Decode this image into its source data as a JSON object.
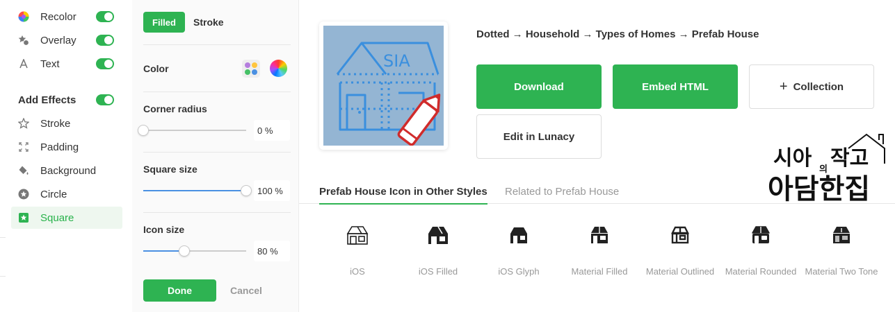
{
  "sidebar": {
    "items": [
      {
        "label": "Recolor",
        "icon": "palette-icon",
        "toggle": true
      },
      {
        "label": "Overlay",
        "icon": "overlay-shapes-icon",
        "toggle": true
      },
      {
        "label": "Text",
        "icon": "text-a-icon",
        "toggle": true
      }
    ],
    "effects_heading": "Add Effects",
    "effects_toggle": true,
    "effects": [
      {
        "label": "Stroke",
        "icon": "star-outline-icon"
      },
      {
        "label": "Padding",
        "icon": "expand-arrows-icon"
      },
      {
        "label": "Background",
        "icon": "paint-bucket-icon"
      },
      {
        "label": "Circle",
        "icon": "star-circle-icon"
      },
      {
        "label": "Square",
        "icon": "star-square-icon",
        "active": true
      }
    ]
  },
  "panel": {
    "tab_filled": "Filled",
    "tab_stroke": "Stroke",
    "color_label": "Color",
    "corner_radius": {
      "label": "Corner radius",
      "value": "0 %",
      "fraction": 0.0
    },
    "square_size": {
      "label": "Square size",
      "value": "100 %",
      "fraction": 1.0
    },
    "icon_size": {
      "label": "Icon size",
      "value": "80 %",
      "fraction": 0.4
    },
    "done": "Done",
    "cancel": "Cancel"
  },
  "main": {
    "preview_icon": "prefab-house-sia-icon",
    "preview_text": "SIA",
    "breadcrumb": "Dotted → Household → Types of Homes → Prefab House",
    "download": "Download",
    "embed": "Embed HTML",
    "collection": "Collection",
    "edit": "Edit in Lunacy",
    "tabs": {
      "active": "Prefab House Icon in Other Styles",
      "inactive": "Related to Prefab House"
    },
    "styles": [
      {
        "name": "iOS",
        "icon": "house-outline-icon"
      },
      {
        "name": "iOS Filled",
        "icon": "house-filled-icon"
      },
      {
        "name": "iOS Glyph",
        "icon": "house-glyph-icon"
      },
      {
        "name": "Material Filled",
        "icon": "house-material-filled-icon"
      },
      {
        "name": "Material Outlined",
        "icon": "house-material-outlined-icon"
      },
      {
        "name": "Material Rounded",
        "icon": "house-material-rounded-icon"
      },
      {
        "name": "Material Two Tone",
        "icon": "house-material-two-tone-icon"
      }
    ]
  },
  "watermark": {
    "line1": "시아",
    "small": "의",
    "line1b": "작고",
    "line2": "아담한집"
  },
  "colors": {
    "accent": "#2eb352",
    "preview_bg": "#94b5d3",
    "icon_blue": "#3a8fde",
    "pencil_red": "#d02b2b",
    "slider_fill": "#4a90e2"
  }
}
